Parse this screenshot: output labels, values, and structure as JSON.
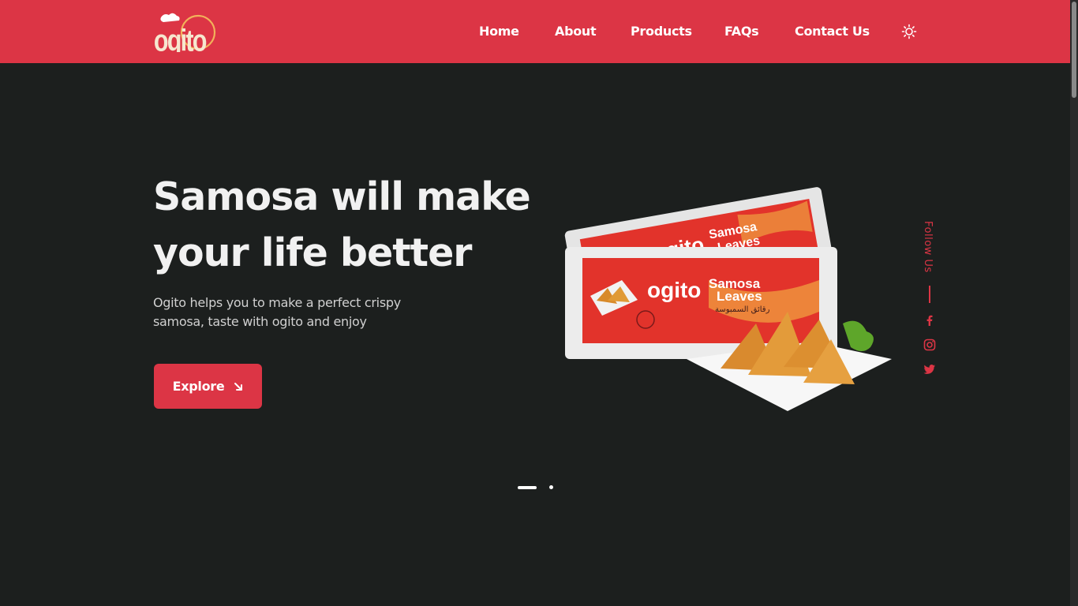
{
  "brand": {
    "logo_text": "ogito",
    "accent": "#dc3545",
    "background": "#1c1f1e"
  },
  "nav": {
    "items": [
      {
        "label": "Home"
      },
      {
        "label": "About"
      },
      {
        "label": "Products"
      },
      {
        "label": "FAQs"
      },
      {
        "label": "Contact Us"
      }
    ],
    "theme_toggle_icon": "sun-icon"
  },
  "hero": {
    "title_line1": "Samosa will make",
    "title_line2": "your life better",
    "desc_line1": "Ogito helps you to make a perfect crispy",
    "desc_line2": "samosa, taste with ogito and enjoy",
    "cta_label": "Explore",
    "cta_icon": "arrow-down-right-icon",
    "product": {
      "package_brand": "ogito",
      "package_title_line1": "Samosa",
      "package_title_line2": "Leaves",
      "package_arabic": "رقائق السمبوسة"
    }
  },
  "follow": {
    "label": "Follow Us",
    "icons": [
      "facebook-icon",
      "instagram-icon",
      "twitter-icon"
    ]
  },
  "slider": {
    "total": 2,
    "active": 1
  }
}
